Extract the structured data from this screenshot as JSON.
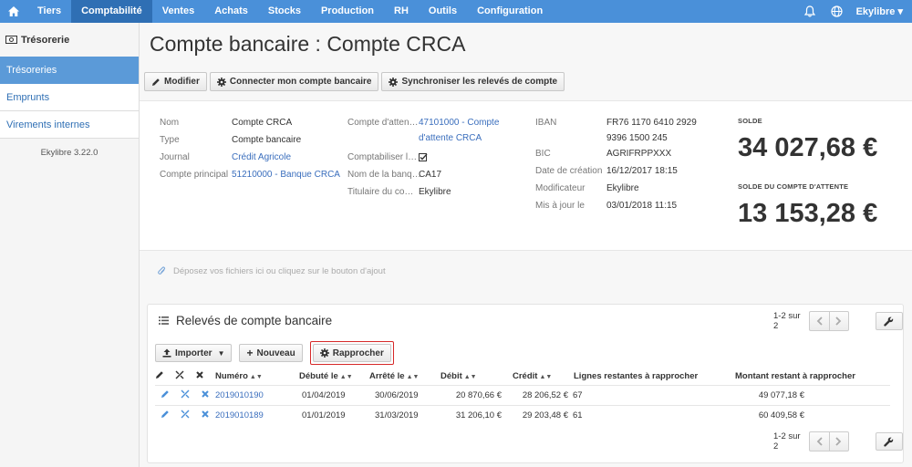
{
  "nav": {
    "items": [
      {
        "label": "Tiers",
        "active": false
      },
      {
        "label": "Comptabilité",
        "active": true
      },
      {
        "label": "Ventes",
        "active": false
      },
      {
        "label": "Achats",
        "active": false
      },
      {
        "label": "Stocks",
        "active": false
      },
      {
        "label": "Production",
        "active": false
      },
      {
        "label": "RH",
        "active": false
      },
      {
        "label": "Outils",
        "active": false
      },
      {
        "label": "Configuration",
        "active": false
      }
    ],
    "user": "Ekylibre"
  },
  "sidebar": {
    "header": "Trésorerie",
    "items": [
      {
        "label": "Trésoreries",
        "active": true
      },
      {
        "label": "Emprunts",
        "active": false
      },
      {
        "label": "Virements internes",
        "active": false
      }
    ],
    "version": "Ekylibre 3.22.0"
  },
  "page": {
    "title": "Compte bancaire : Compte CRCA",
    "toolbar": {
      "modify": "Modifier",
      "connect": "Connecter mon compte bancaire",
      "sync": "Synchroniser les relevés de compte"
    }
  },
  "details": {
    "col1": [
      {
        "key": "Nom",
        "value": "Compte CRCA",
        "link": false
      },
      {
        "key": "Type",
        "value": "Compte bancaire",
        "link": false
      },
      {
        "key": "Journal",
        "value": "Crédit Agricole",
        "link": true
      },
      {
        "key": "Compte principal",
        "value": "51210000 - Banque CRCA",
        "link": true
      }
    ],
    "col2": {
      "waiting_key": "Compte d'atten…",
      "waiting_value_1": "47101000 - Compte",
      "waiting_value_2": "d'attente CRCA",
      "comptabiliser_key": "Comptabiliser l…",
      "bank_key": "Nom de la banq…",
      "bank_value": "CA17",
      "holder_key": "Titulaire du co…",
      "holder_value": "Ekylibre"
    },
    "col3": {
      "iban_key": "IBAN",
      "iban_value_1": "FR76 1170 6410 2929",
      "iban_value_2": "9396 1500 245",
      "bic_key": "BIC",
      "bic_value": "AGRIFRPPXXX",
      "created_key": "Date de création",
      "created_value": "16/12/2017 18:15",
      "modifier_key": "Modificateur",
      "modifier_value": "Ekylibre",
      "updated_key": "Mis à jour le",
      "updated_value": "03/01/2018 11:15"
    },
    "solde_label": "SOLDE",
    "solde_value": "34 027,68 €",
    "solde_attente_label": "SOLDE DU COMPTE D'ATTENTE",
    "solde_attente_value": "13 153,28 €"
  },
  "dropzone": "Déposez vos fichiers ici ou cliquez sur le bouton d'ajout",
  "statements": {
    "title": "Relevés de compte bancaire",
    "pagination": "1-2 sur 2",
    "import_label": "Importer",
    "new_label": "Nouveau",
    "reconcile_label": "Rapprocher",
    "columns": {
      "numero": "Numéro",
      "debut": "Débuté le",
      "arrete": "Arrêté le",
      "debit": "Débit",
      "credit": "Crédit",
      "lignes": "Lignes restantes à rapprocher",
      "montant": "Montant restant à rapprocher"
    },
    "rows": [
      {
        "numero": "2019010190",
        "debut": "01/04/2019",
        "arrete": "30/06/2019",
        "debit": "20 870,66 €",
        "credit": "28 206,52 €",
        "lignes": "67",
        "montant": "49 077,18 €"
      },
      {
        "numero": "2019010189",
        "debut": "01/01/2019",
        "arrete": "31/03/2019",
        "debit": "31 206,10 €",
        "credit": "29 203,48 €",
        "lignes": "61",
        "montant": "60 409,58 €"
      }
    ]
  },
  "colors": {
    "nav_bg": "#4a90d9",
    "nav_active": "#2f6fb4",
    "link": "#3a6ebd",
    "highlight": "#d62828"
  }
}
